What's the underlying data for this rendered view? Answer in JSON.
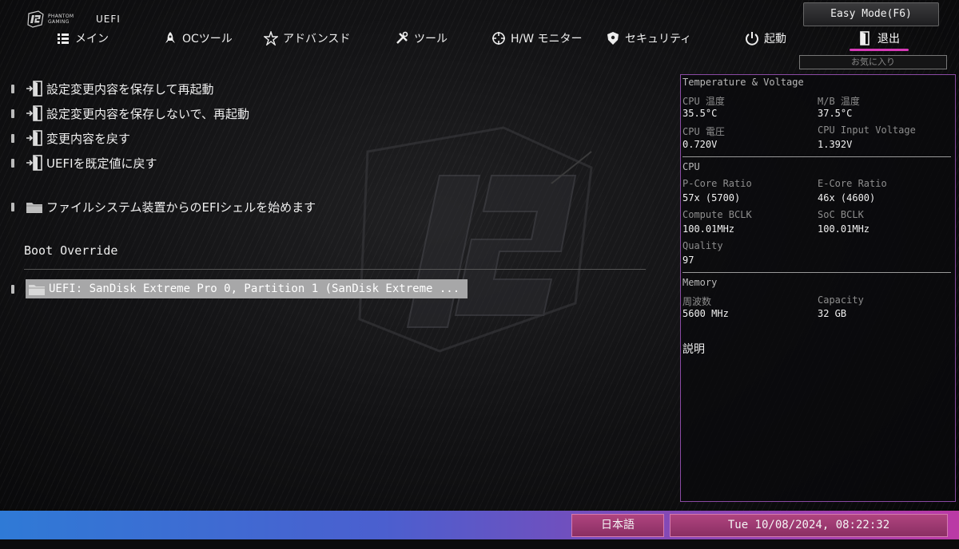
{
  "header": {
    "brand_line1": "PHANTOM",
    "brand_line2": "GAMING",
    "product": "UEFI",
    "easy_mode_label": "Easy Mode(F6)",
    "favorites_label": "お気に入り"
  },
  "nav": {
    "tabs": [
      {
        "label": "メイン",
        "icon": "list-icon"
      },
      {
        "label": "OCツール",
        "icon": "rocket-icon"
      },
      {
        "label": "アドバンスド",
        "icon": "star-icon"
      },
      {
        "label": "ツール",
        "icon": "tools-icon"
      },
      {
        "label": "H/W モニター",
        "icon": "crosshair-icon"
      },
      {
        "label": "セキュリティ",
        "icon": "shield-icon"
      },
      {
        "label": "起動",
        "icon": "power-icon"
      },
      {
        "label": "退出",
        "icon": "exit-door-icon",
        "active": true
      }
    ]
  },
  "exit_menu": {
    "items": [
      {
        "label": "設定変更内容を保存して再起動",
        "icon": "exit-icon"
      },
      {
        "label": "設定変更内容を保存しないで、再起動",
        "icon": "exit-icon"
      },
      {
        "label": "変更内容を戻す",
        "icon": "exit-icon"
      },
      {
        "label": "UEFIを既定値に戻す",
        "icon": "exit-icon"
      },
      {
        "label": "ファイルシステム装置からのEFIシェルを始めます",
        "icon": "folder-icon"
      }
    ],
    "boot_override_title": "Boot Override",
    "boot_override_items": [
      {
        "label": "UEFI: SanDisk Extreme Pro 0, Partition 1 (SanDisk Extreme ...",
        "icon": "folder-icon",
        "selected": true
      }
    ]
  },
  "monitor": {
    "temp_voltage_title": "Temperature & Voltage",
    "cpu_temp_label": "CPU 温度",
    "cpu_temp_value": "35.5°C",
    "mb_temp_label": "M/B 温度",
    "mb_temp_value": "37.5°C",
    "cpu_voltage_label": "CPU 電圧",
    "cpu_voltage_value": "0.720V",
    "cpu_input_voltage_label": "CPU Input Voltage",
    "cpu_input_voltage_value": "1.392V",
    "cpu_title": "CPU",
    "pcore_label": "P-Core Ratio",
    "pcore_value": "57x (5700)",
    "ecore_label": "E-Core Ratio",
    "ecore_value": "46x (4600)",
    "compute_bclk_label": "Compute BCLK",
    "compute_bclk_value": "100.01MHz",
    "soc_bclk_label": "SoC BCLK",
    "soc_bclk_value": "100.01MHz",
    "quality_label": "Quality",
    "quality_value": "97",
    "memory_title": "Memory",
    "freq_label": "周波数",
    "freq_value": "5600 MHz",
    "capacity_label": "Capacity",
    "capacity_value": "32 GB",
    "description_title": "説明"
  },
  "footer": {
    "language": "日本語",
    "datetime": "Tue 10/08/2024, 08:22:32"
  },
  "colors": {
    "accent_magenta": "#d63ab7",
    "bar_blue": "#2f7ad6",
    "bar_pink": "#bb3aa5",
    "selection_gray": "#a7a7a8"
  }
}
